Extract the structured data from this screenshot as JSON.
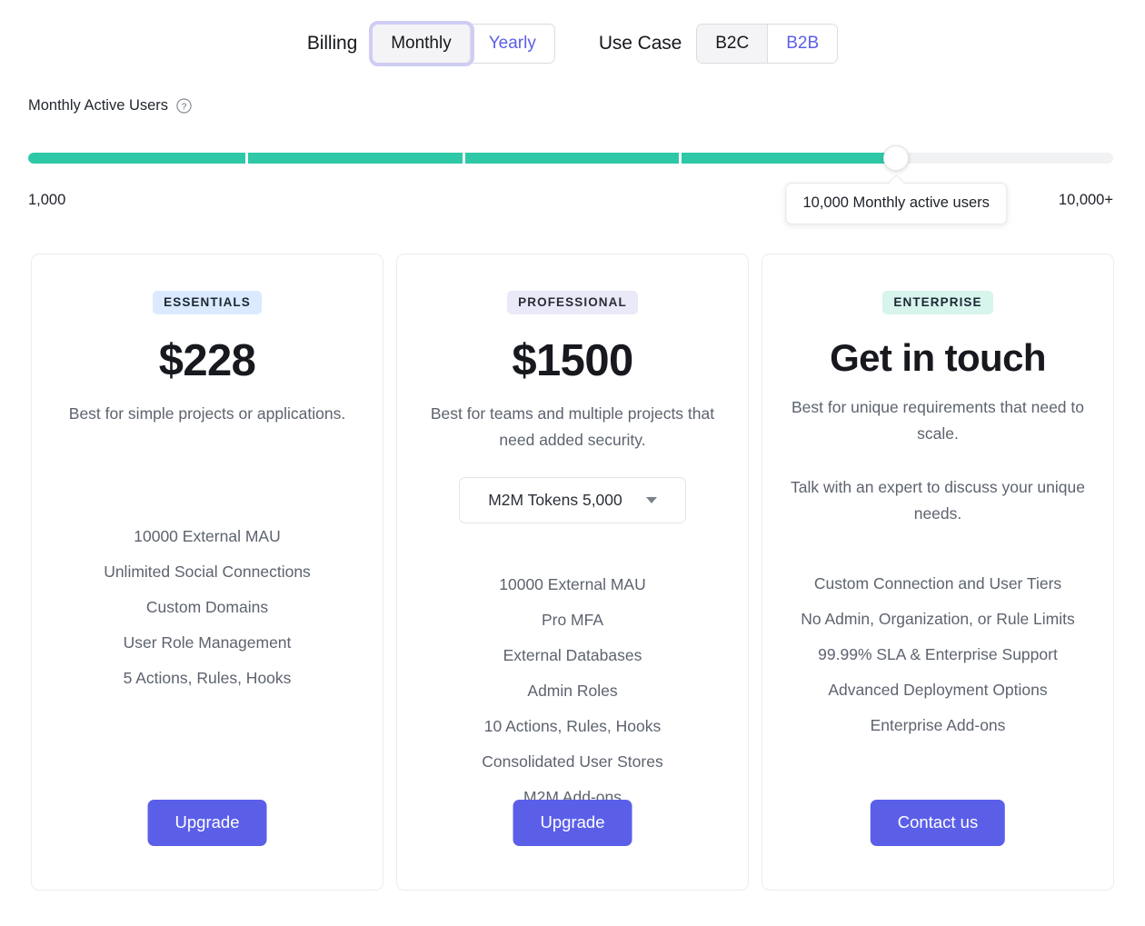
{
  "controls": {
    "billing": {
      "label": "Billing",
      "options": [
        {
          "label": "Monthly",
          "selected": true
        },
        {
          "label": "Yearly",
          "selected": false
        }
      ]
    },
    "use_case": {
      "label": "Use Case",
      "options": [
        {
          "label": "B2C",
          "selected": true
        },
        {
          "label": "B2B",
          "selected": false
        }
      ]
    }
  },
  "slider": {
    "title": "Monthly Active Users",
    "help_icon": "question-circle-icon",
    "min_label": "1,000",
    "max_label": "10,000+",
    "tooltip": "10,000 Monthly active users",
    "fill_percent": 80,
    "handle_percent": 80,
    "tick_percents": [
      20,
      40,
      60
    ],
    "fill_color": "#2ec8a6",
    "track_color": "#f1f2f3"
  },
  "cards": [
    {
      "badge": "ESSENTIALS",
      "price": "$228",
      "description": "Best for simple projects or applications.",
      "features": [
        "10000 External MAU",
        "Unlimited Social Connections",
        "Custom Domains",
        "User Role Management",
        "5 Actions, Rules, Hooks"
      ],
      "cta": "Upgrade"
    },
    {
      "badge": "PROFESSIONAL",
      "price": "$1500",
      "description": "Best for teams and multiple projects that need added security.",
      "dropdown": "M2M Tokens 5,000",
      "features": [
        "10000 External MAU",
        "Pro MFA",
        "External Databases",
        "Admin Roles",
        "10 Actions, Rules, Hooks",
        "Consolidated User Stores",
        "M2M Add-ons"
      ],
      "cta": "Upgrade"
    },
    {
      "badge": "ENTERPRISE",
      "price": "Get in touch",
      "description": "Best for unique requirements that need to scale.",
      "description2": "Talk with an expert to discuss your unique needs.",
      "features": [
        "Custom Connection and User Tiers",
        "No Admin, Organization, or Rule Limits",
        "99.99% SLA & Enterprise Support",
        "Advanced Deployment Options",
        "Enterprise Add-ons"
      ],
      "cta": "Contact us"
    }
  ],
  "theme": {
    "accent": "#5b5fe8",
    "slider_fill": "#2ec8a6",
    "badge_essentials_bg": "#dbeafe",
    "badge_professional_bg": "#e9e9f7",
    "badge_enterprise_bg": "#d7f5ec"
  }
}
